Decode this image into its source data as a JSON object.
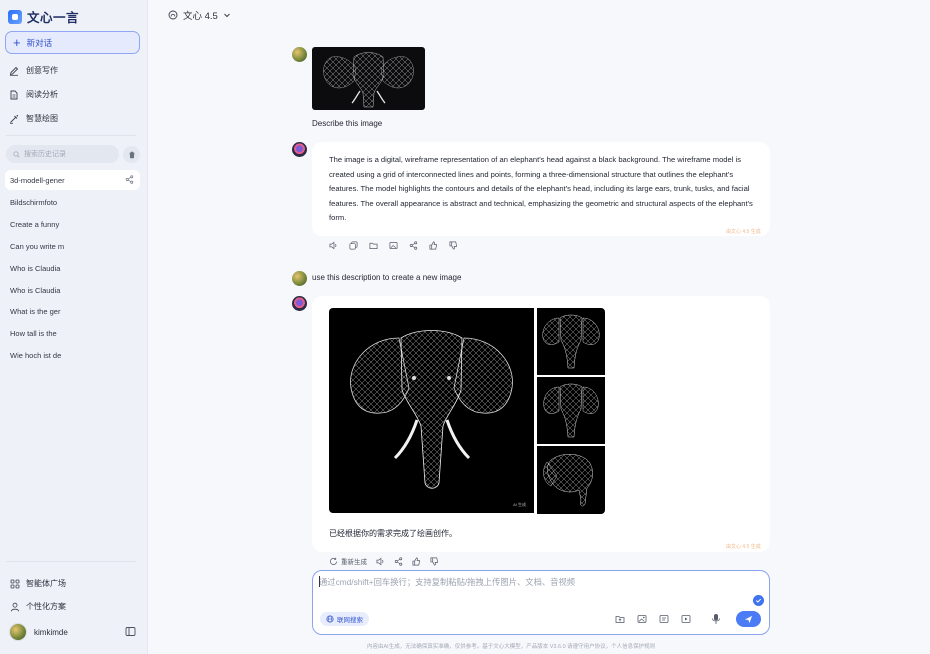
{
  "sidebar": {
    "logo_text": "文心一言",
    "new_chat": "新对话",
    "nav": [
      {
        "label": "创意写作",
        "icon": "pen-icon"
      },
      {
        "label": "阅读分析",
        "icon": "document-icon"
      },
      {
        "label": "智慧绘图",
        "icon": "paint-icon"
      }
    ],
    "search_placeholder": "搜索历史记录",
    "history": [
      "3d-modell-gener",
      "Bildschirmfoto",
      "Create a funny",
      "Can you write m",
      "Who is Claudia",
      "Who is Claudia",
      "What is the ger",
      "How tall is the",
      "Wie hoch ist de"
    ],
    "bottom": [
      {
        "label": "智能体广场",
        "icon": "grid-icon"
      },
      {
        "label": "个性化方案",
        "icon": "person-icon"
      }
    ],
    "username": "kimkimde"
  },
  "header": {
    "model": "文心 4.5"
  },
  "chat": {
    "user_msg_1": "Describe this image",
    "bot_reply_1": "The image is a digital, wireframe representation of an elephant's head against a black background. The wireframe model is created using a grid of interconnected lines and points, forming a three-dimensional structure that outlines the elephant's features. The model highlights the contours and details of the elephant's head, including its large ears, trunk, tusks, and facial features. The overall appearance is abstract and technical, emphasizing the geometric and structural aspects of the elephant's form.",
    "model_tag": "由文心 4.5 生成",
    "user_msg_2": "use this description to create a new image",
    "bot_reply_2": "已经根据你的需求完成了绘画创作。",
    "regenerate_label": "重新生成",
    "ai_mark": "AI 生成"
  },
  "input": {
    "placeholder": "通过cmd/shift+回车换行；支持复制粘贴/拖拽上传图片、文档、音视频",
    "web_search": "联网搜索"
  },
  "footer": "内容由AI生成，无法确保真实准确，仅供参考。基于文心大模型，产品版本 V3.6.0 请遵守用户协议，个人信息保护规则"
}
